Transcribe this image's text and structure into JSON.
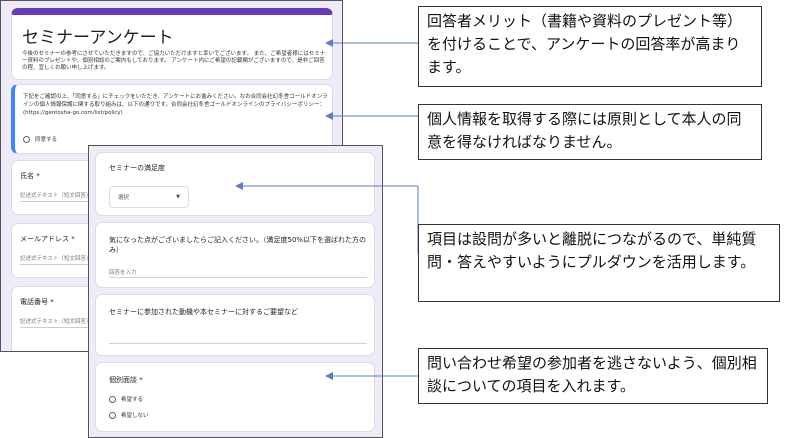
{
  "back_form": {
    "title": "セミナーアンケート",
    "description": "今後のセミナーの参考にさせていただきますので、ご協力いただけますと幸いでございます。 また、ご希望者様にはセミナー資料のプレゼントや、個別相談のご案内もしております。 アンケート内にご希望の記載欄がございますので、是非ご回答の程、宜しくお願い申し上げます。",
    "consent_text": "下記をご確認の上、「同意する」にチェックをいただき、アンケートにお進みください。なお合同会社幻冬舎ゴールドオンラインの個人情報保護に関する取り組みは、以下の通りです。合同会社幻冬舎ゴールドオンラインのプライバシーポリシー：(https://gentosha-go.com/list/policy)",
    "consent_option": "同意する",
    "questions": [
      {
        "label": "氏名 *",
        "hint": "記述式テキスト（短文回答）"
      },
      {
        "label": "メールアドレス *",
        "hint": "記述式テキスト（短文回答）"
      },
      {
        "label": "電話番号 *",
        "hint": "記述式テキスト（短文回答）"
      }
    ]
  },
  "front_form": {
    "satisfaction": {
      "label": "セミナーの満足度",
      "select_value": "選択"
    },
    "feedback": {
      "label": "気になった点がございましたらご記入ください。（満足度50%以下を選ばれた方のみ）",
      "placeholder": "回答を入力"
    },
    "motivation": {
      "label": "セミナーに参加された動機や本セミナーに対するご要望など"
    },
    "consultation": {
      "label": "個別面談 *",
      "options": [
        "希望する",
        "希望しない"
      ]
    }
  },
  "callouts": [
    "回答者メリット（書籍や資料のプレゼント等）を付けることで、アンケートの回答率が高まります。",
    "個人情報を取得する際には原則として本人の同意を得なければなりません。",
    "項目は設問が多いと離脱につながるので、単純質問・答えやすいようにプルダウンを活用します。",
    "問い合わせ希望の参加者を逃さないよう、個別相談についての項目を入れます。"
  ],
  "colors": {
    "form_background": "#f0ebf8",
    "accent_purple": "#673ab7",
    "active_blue": "#4285f4",
    "arrow": "#5b7fbf"
  }
}
